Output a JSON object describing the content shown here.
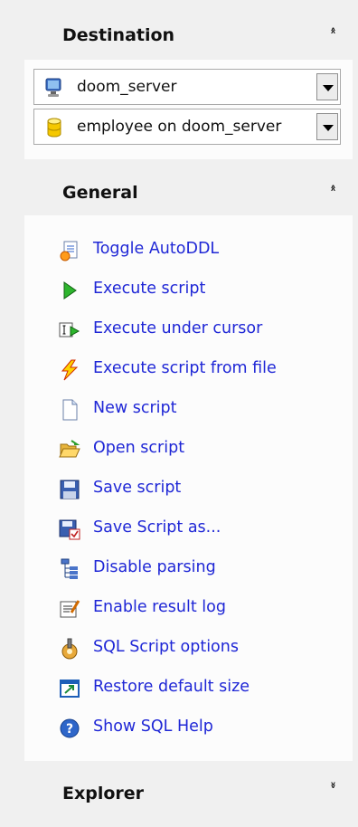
{
  "destination": {
    "title": "Destination",
    "server": "doom_server",
    "database": "employee on doom_server"
  },
  "general": {
    "title": "General",
    "items": [
      {
        "label": "Toggle AutoDDL",
        "icon": "toggle-autoddl-icon"
      },
      {
        "label": "Execute script",
        "icon": "execute-icon"
      },
      {
        "label": "Execute under cursor",
        "icon": "execute-cursor-icon"
      },
      {
        "label": "Execute script from file",
        "icon": "lightning-icon"
      },
      {
        "label": "New script",
        "icon": "new-document-icon"
      },
      {
        "label": "Open script",
        "icon": "open-folder-icon"
      },
      {
        "label": "Save script",
        "icon": "floppy-disk-icon"
      },
      {
        "label": "Save Script as...",
        "icon": "save-as-icon"
      },
      {
        "label": "Disable parsing",
        "icon": "tree-icon"
      },
      {
        "label": "Enable result log",
        "icon": "log-edit-icon"
      },
      {
        "label": "SQL Script options",
        "icon": "options-icon"
      },
      {
        "label": "Restore default size",
        "icon": "restore-size-icon"
      },
      {
        "label": "Show SQL Help",
        "icon": "help-icon"
      }
    ]
  },
  "explorer": {
    "title": "Explorer"
  }
}
